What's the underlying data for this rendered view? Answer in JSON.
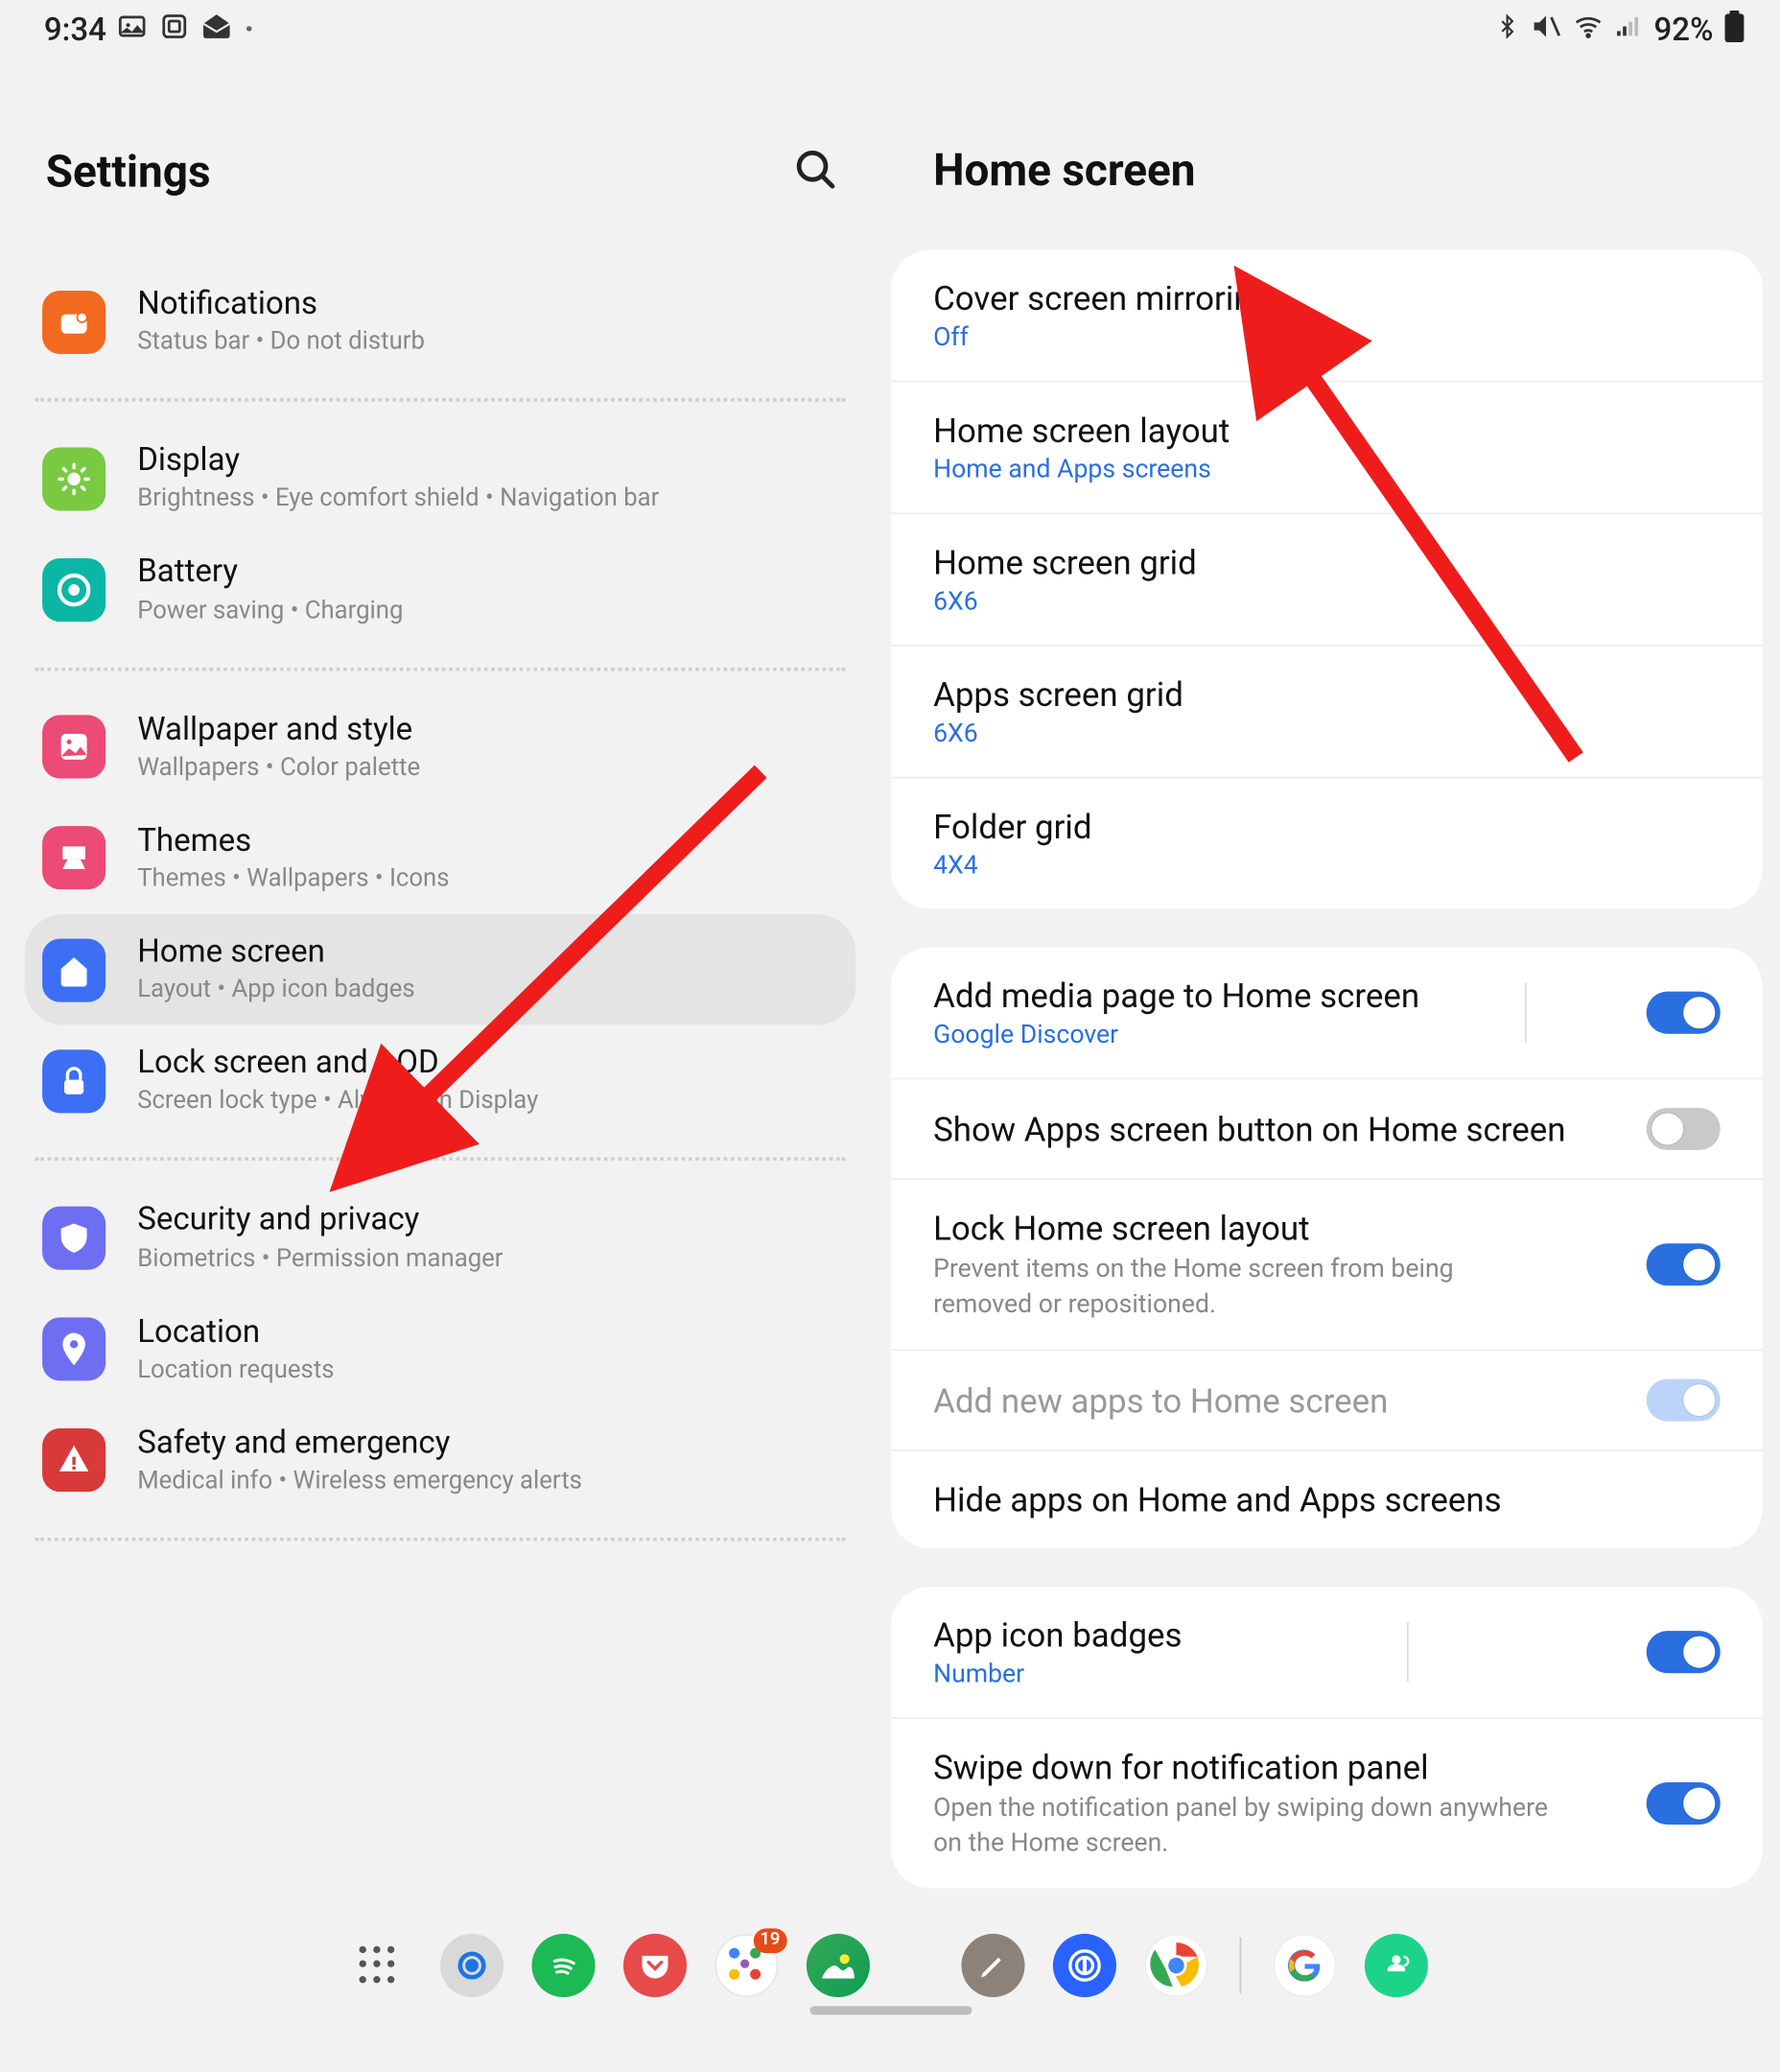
{
  "status": {
    "time": "9:34",
    "battery_pct": "92%"
  },
  "left": {
    "title": "Settings",
    "groups": [
      [
        {
          "key": "notifications",
          "label": "Notifications",
          "sub": "Status bar  •  Do not disturb",
          "icon_bg": "#f16a1f",
          "icon": "notifications"
        }
      ],
      [
        {
          "key": "display",
          "label": "Display",
          "sub": "Brightness  •  Eye comfort shield  •  Navigation bar",
          "icon_bg": "#7ac943",
          "icon": "display"
        },
        {
          "key": "battery",
          "label": "Battery",
          "sub": "Power saving  •  Charging",
          "icon_bg": "#0bb7a4",
          "icon": "battery"
        }
      ],
      [
        {
          "key": "wallpaper",
          "label": "Wallpaper and style",
          "sub": "Wallpapers  •  Color palette",
          "icon_bg": "#ec4a77",
          "icon": "wallpaper"
        },
        {
          "key": "themes",
          "label": "Themes",
          "sub": "Themes  •  Wallpapers  •  Icons",
          "icon_bg": "#ec4a77",
          "icon": "themes"
        },
        {
          "key": "home",
          "label": "Home screen",
          "sub": "Layout  •  App icon badges",
          "icon_bg": "#3d6ff4",
          "icon": "home",
          "selected": true
        },
        {
          "key": "lock",
          "label": "Lock screen and AOD",
          "sub": "Screen lock type  •  Always On Display",
          "icon_bg": "#3d6ff4",
          "icon": "lock"
        }
      ],
      [
        {
          "key": "security",
          "label": "Security and privacy",
          "sub": "Biometrics  •  Permission manager",
          "icon_bg": "#6e6ef2",
          "icon": "security"
        },
        {
          "key": "location",
          "label": "Location",
          "sub": "Location requests",
          "icon_bg": "#6e6ef2",
          "icon": "location"
        },
        {
          "key": "safety",
          "label": "Safety and emergency",
          "sub": "Medical info  •  Wireless emergency alerts",
          "icon_bg": "#d83a3a",
          "icon": "safety"
        }
      ]
    ]
  },
  "right": {
    "title": "Home screen",
    "sections": [
      [
        {
          "title": "Cover screen mirroring",
          "value": "Off"
        },
        {
          "title": "Home screen layout",
          "value": "Home and Apps screens"
        },
        {
          "title": "Home screen grid",
          "value": "6X6"
        },
        {
          "title": "Apps screen grid",
          "value": "6X6"
        },
        {
          "title": "Folder grid",
          "value": "4X4"
        }
      ],
      [
        {
          "title": "Add media page to Home screen",
          "value": "Google Discover",
          "toggle": "on",
          "sep": true
        },
        {
          "title": "Show Apps screen button on Home screen",
          "toggle": "off"
        },
        {
          "title": "Lock Home screen layout",
          "sub": "Prevent items on the Home screen from being removed or repositioned.",
          "toggle": "on"
        },
        {
          "title": "Add new apps to Home screen",
          "dim": true,
          "toggle": "on-dim"
        },
        {
          "title": "Hide apps on Home and Apps screens"
        }
      ],
      [
        {
          "title": "App icon badges",
          "value": "Number",
          "toggle": "on",
          "sep": true
        },
        {
          "title": "Swipe down for notification panel",
          "sub": "Open the notification panel by swiping down anywhere on the Home screen.",
          "toggle": "on"
        }
      ]
    ]
  },
  "taskbar": {
    "badge": "19",
    "apps": [
      "grid",
      "target",
      "spotify",
      "pocket",
      "cluster",
      "gallery",
      "gap",
      "pencil",
      "onepass",
      "chrome",
      "divider",
      "google",
      "share"
    ]
  }
}
